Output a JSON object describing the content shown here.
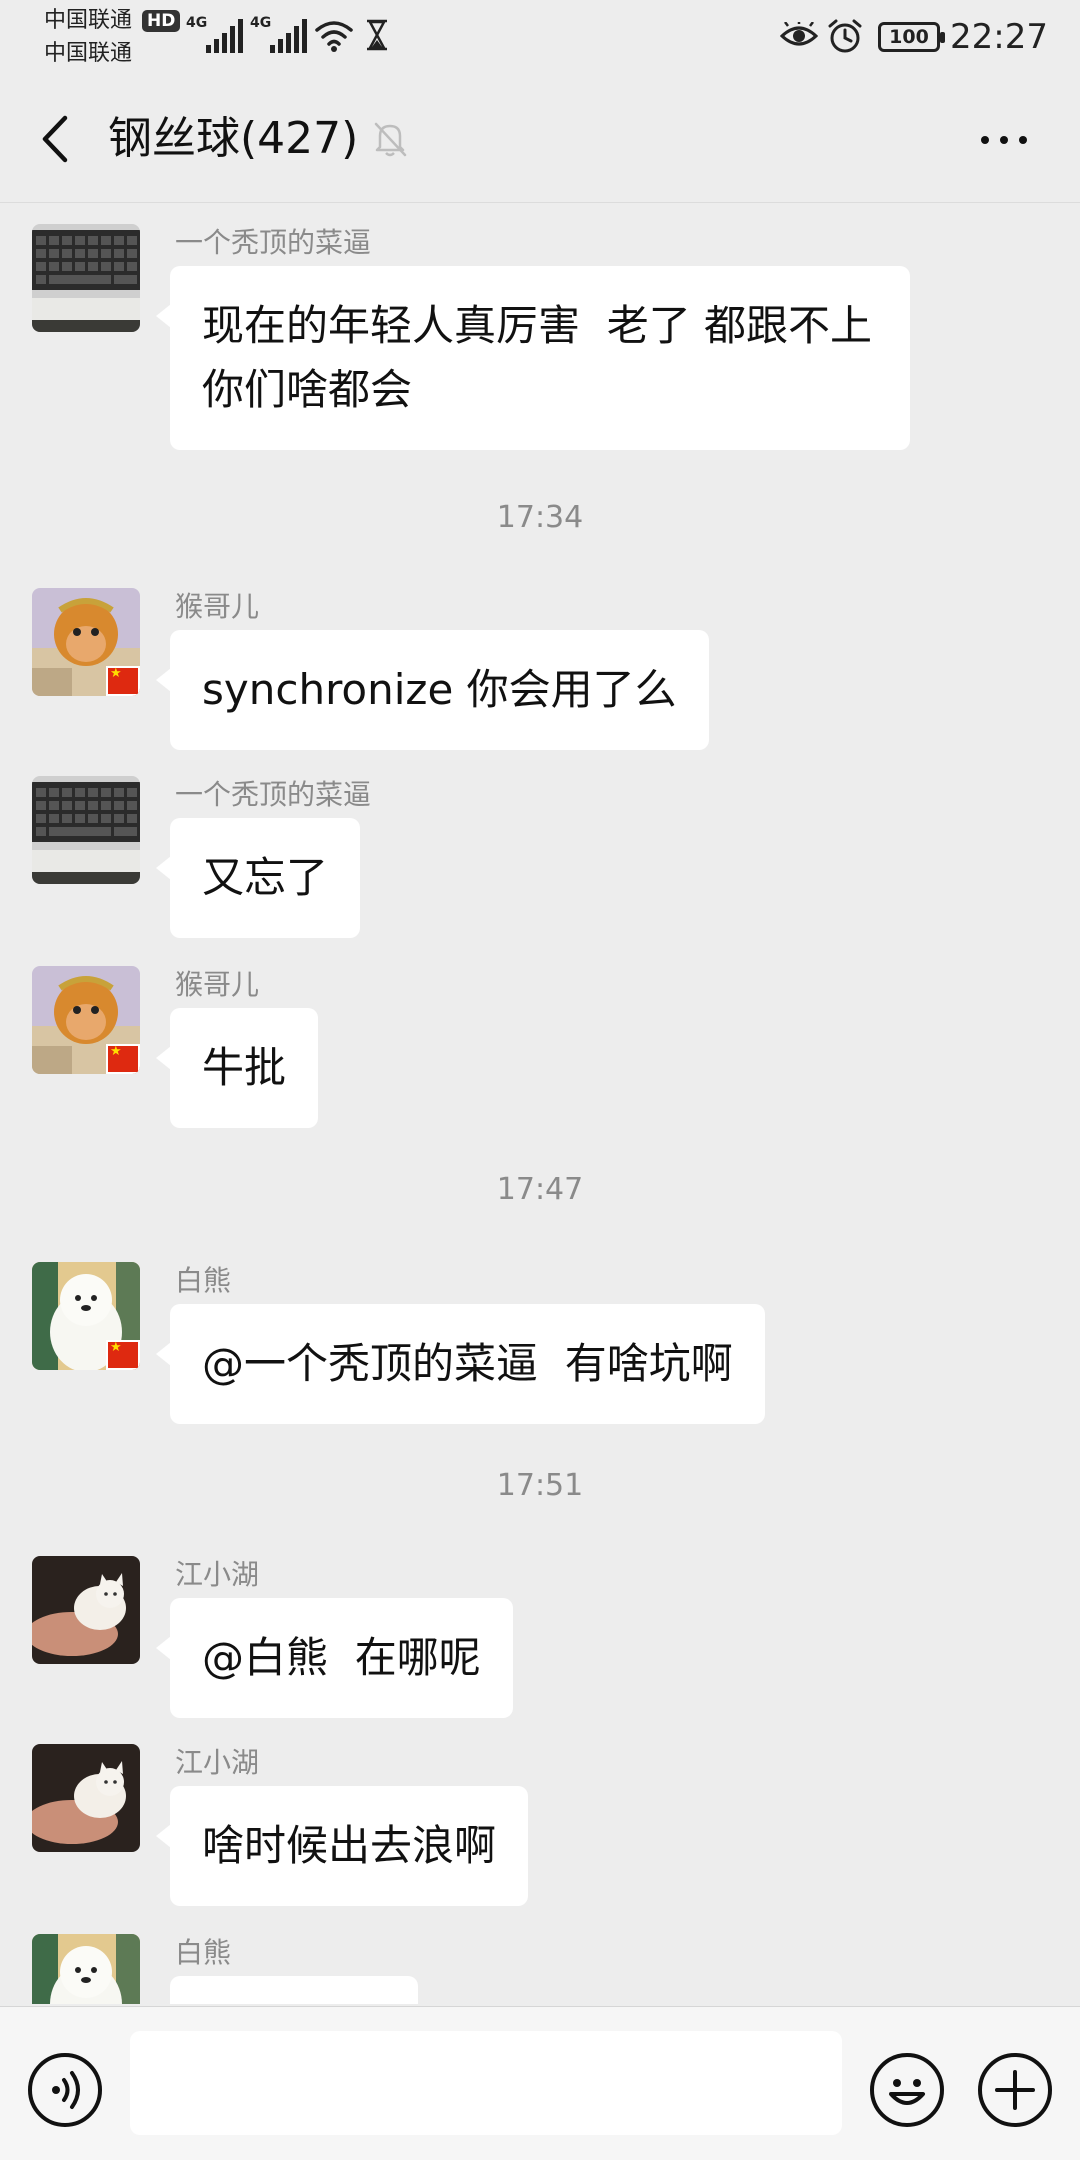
{
  "status_bar": {
    "carrier_1": "中国联通",
    "carrier_2": "中国联通",
    "hd_badge": "HD",
    "network_1": "4G",
    "network_2": "4G",
    "battery": "100",
    "time": "22:27"
  },
  "header": {
    "title": "钢丝球(427)",
    "back_icon": "chevron-left-icon",
    "mute_icon": "bell-muted-icon",
    "more_icon": "ellipsis-icon"
  },
  "messages": [
    {
      "type": "message",
      "sender": "一个秃顶的菜逼",
      "text": "现在的年轻人真厉害  老了 都跟不上   你们啥都会",
      "avatar": "keyboard"
    },
    {
      "type": "time",
      "text": "17:34"
    },
    {
      "type": "message",
      "sender": "猴哥儿",
      "text": "synchronize 你会用了么",
      "avatar": "monkey"
    },
    {
      "type": "message",
      "sender": "一个秃顶的菜逼",
      "text": "又忘了",
      "avatar": "keyboard"
    },
    {
      "type": "message",
      "sender": "猴哥儿",
      "text": "牛批",
      "avatar": "monkey"
    },
    {
      "type": "time",
      "text": "17:47"
    },
    {
      "type": "message",
      "sender": "白熊",
      "text": "@一个秃顶的菜逼  有啥坑啊",
      "avatar": "bear"
    },
    {
      "type": "time",
      "text": "17:51"
    },
    {
      "type": "message",
      "sender": "江小湖",
      "text": "@白熊  在哪呢",
      "avatar": "cat"
    },
    {
      "type": "message",
      "sender": "江小湖",
      "text": "啥时候出去浪啊",
      "avatar": "cat"
    },
    {
      "type": "message",
      "sender": "白熊",
      "text": "",
      "avatar": "bear"
    }
  ],
  "input_bar": {
    "voice_icon": "voice-icon",
    "input_value": "",
    "emoji_icon": "emoji-icon",
    "plus_icon": "plus-icon"
  },
  "colors": {
    "background": "#ededed",
    "bubble": "#ffffff",
    "secondary_text": "#8a8a8a",
    "input_bar": "#f6f6f6"
  }
}
